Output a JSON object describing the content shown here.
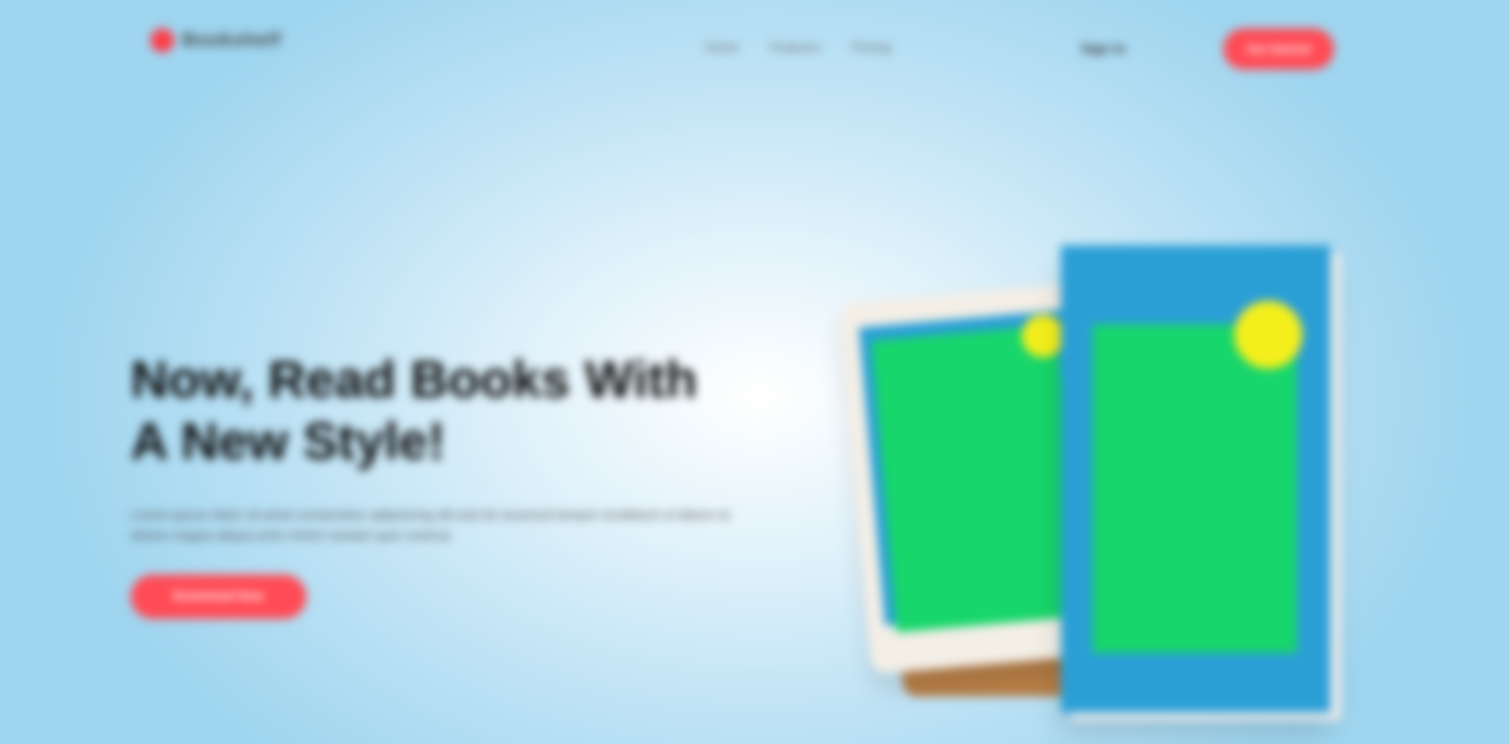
{
  "nav": {
    "brand": "Bookshelf",
    "menu": [
      "Home",
      "Features",
      "Pricing"
    ],
    "signin_label": "Sign In",
    "cta_label": "Get Started"
  },
  "hero": {
    "headline_line1": "Now, Read Books With",
    "headline_line2": "A New Style!",
    "description": "Lorem ipsum dolor sit amet consectetur adipisicing elit sed do eiusmod tempor incididunt ut labore et dolore magna aliqua enim minim veniam quis nostrud.",
    "cta_label": "Download Now"
  },
  "icons": {
    "logo": "circle-logo-icon"
  },
  "colors": {
    "accent": "#ff4b55",
    "sky": "#9fd5ef",
    "book_blue": "#2a9fd6",
    "book_green": "#17d66b",
    "badge_yellow": "#f4ef1c"
  }
}
